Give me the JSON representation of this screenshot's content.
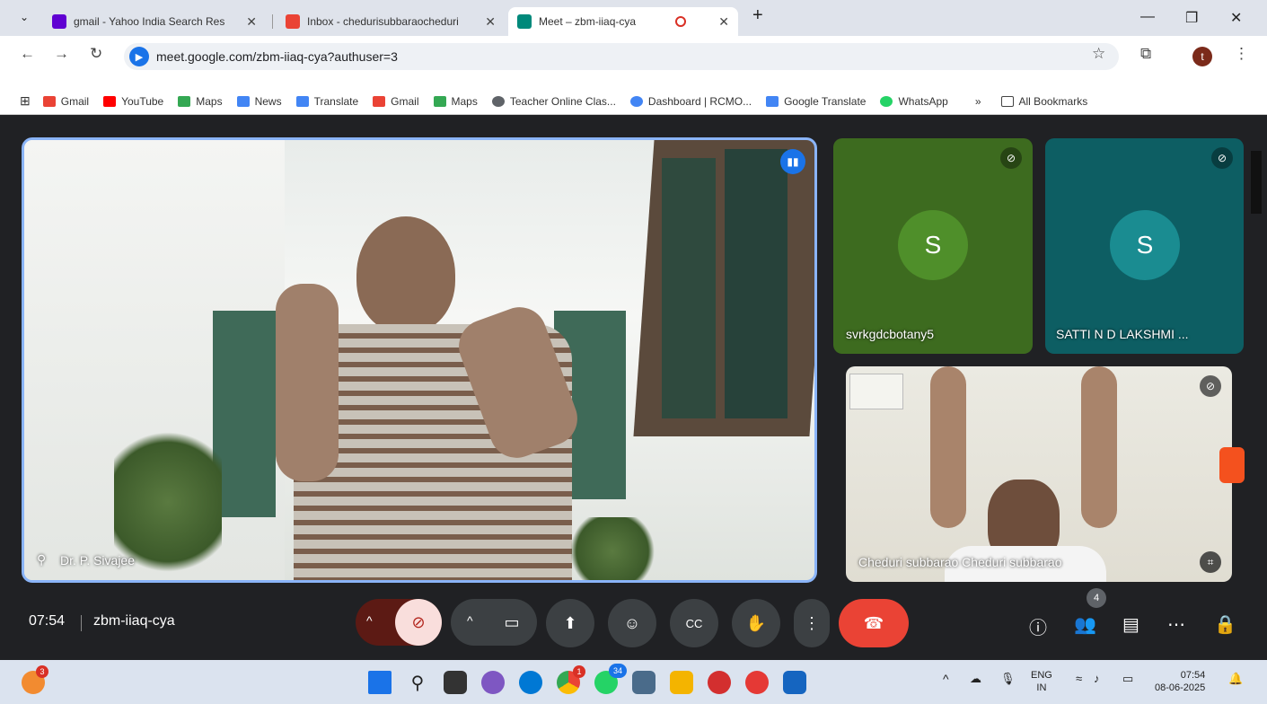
{
  "tabs": [
    {
      "label": "gmail - Yahoo India Search Res",
      "close": "✕"
    },
    {
      "label": "Inbox - chedurisubbaraocheduri",
      "close": "✕"
    },
    {
      "label": "Meet – zbm-iiaq-cya",
      "close": "✕"
    }
  ],
  "new_tab": "+",
  "window": {
    "minimize": "—",
    "restore": "❐",
    "close": "✕"
  },
  "address": {
    "url": "meet.google.com/zbm-iiaq-cya?authuser=3"
  },
  "profile_initial": "t",
  "bookmarks": [
    {
      "label": "Gmail",
      "color": "#ea4335"
    },
    {
      "label": "YouTube",
      "color": "#ff0000"
    },
    {
      "label": "Maps",
      "color": "#34a853"
    },
    {
      "label": "News",
      "color": "#4285f4"
    },
    {
      "label": "Translate",
      "color": "#4285f4"
    },
    {
      "label": "Gmail",
      "color": "#ea4335"
    },
    {
      "label": "Maps",
      "color": "#34a853"
    },
    {
      "label": "Teacher Online Clas...",
      "color": "#5f6368"
    },
    {
      "label": "Dashboard | RCMO...",
      "color": "#4285f4"
    },
    {
      "label": "Google Translate",
      "color": "#4285f4"
    },
    {
      "label": "WhatsApp",
      "color": "#25d366"
    }
  ],
  "bookmarks_more": "»",
  "bookmarks_all": "All Bookmarks",
  "meet": {
    "main_participant": "Dr. P. Sivajee",
    "participants": [
      {
        "name": "svrkgdcbotany5",
        "initial": "S",
        "bg": "#3d6b1f",
        "avatar": "#4f8f2a"
      },
      {
        "name": "SATTI N D LAKSHMI ...",
        "initial": "S",
        "bg": "#0d5e63",
        "avatar": "#1a8c91"
      },
      {
        "name": "Cheduri subbarao Cheduri subbarao"
      }
    ],
    "time": "07:54",
    "meeting_code": "zbm-iiaq-cya",
    "people_count": "4"
  },
  "taskbar": {
    "notification_badge": "3",
    "chrome_badge": "1",
    "whatsapp_badge": "34",
    "lang_top": "ENG",
    "lang_bottom": "IN",
    "clock_time": "07:54",
    "clock_date": "08-06-2025"
  }
}
